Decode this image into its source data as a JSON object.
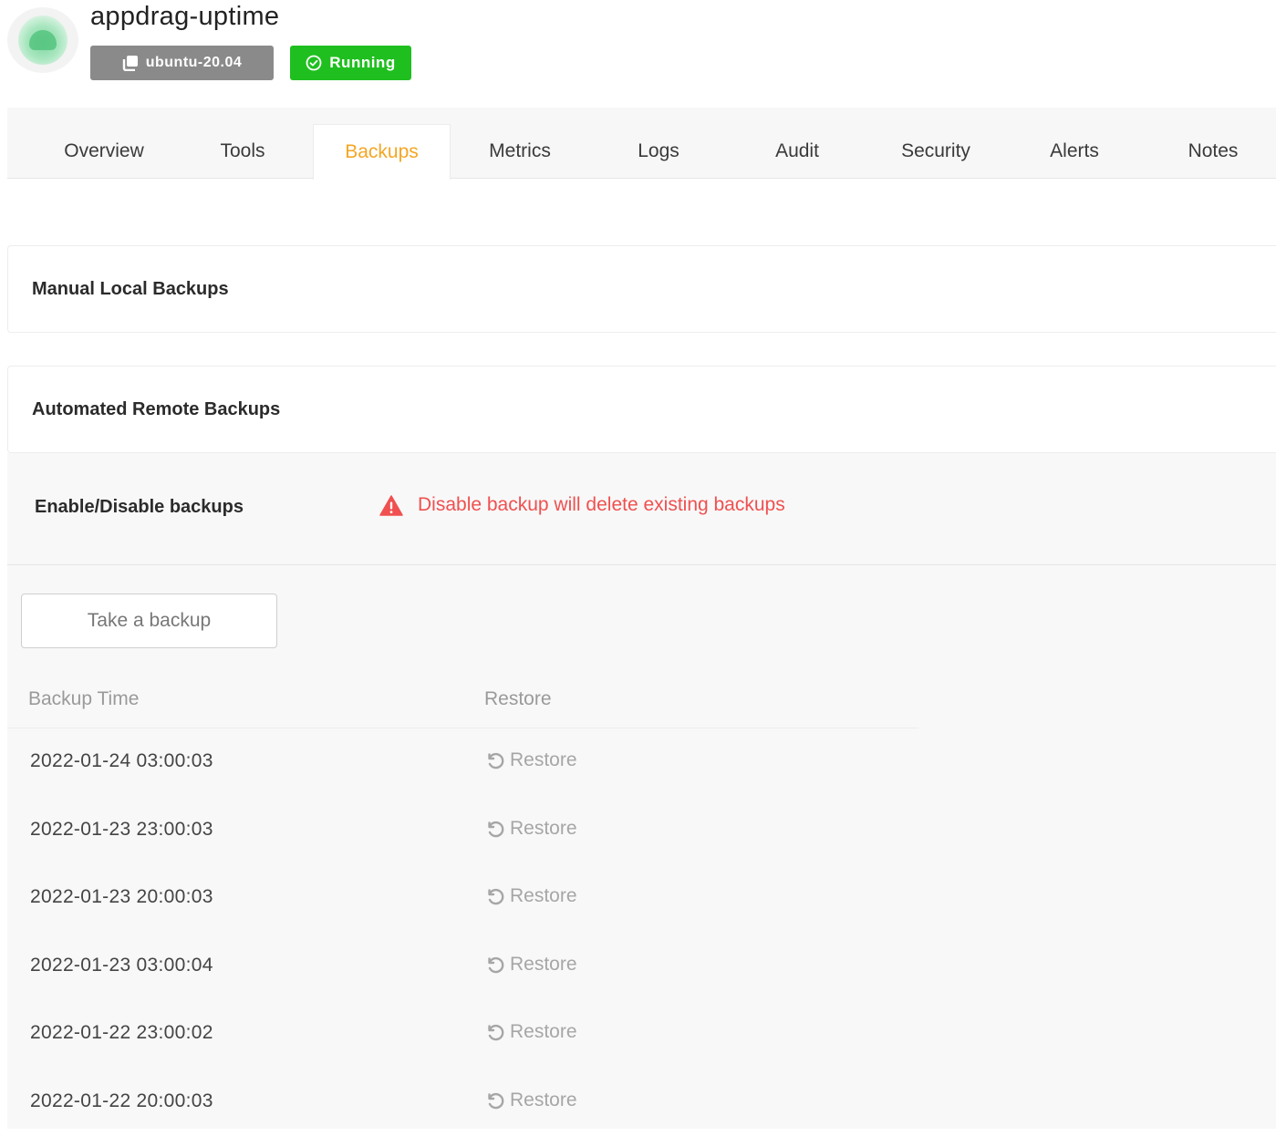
{
  "app": {
    "title": "appdrag-uptime",
    "os_badge": "ubuntu-20.04",
    "status_badge": "Running",
    "colors": {
      "status": "#1fbf1f",
      "os_badge": "#8a8a8a",
      "accent": "#f5a623",
      "warning": "#f05050"
    }
  },
  "tabs": [
    {
      "label": "Overview"
    },
    {
      "label": "Tools"
    },
    {
      "label": "Backups",
      "active": true
    },
    {
      "label": "Metrics"
    },
    {
      "label": "Logs"
    },
    {
      "label": "Audit"
    },
    {
      "label": "Security"
    },
    {
      "label": "Alerts"
    },
    {
      "label": "Notes"
    }
  ],
  "sections": {
    "manual": {
      "title": "Manual Local Backups"
    },
    "remote": {
      "title": "Automated Remote Backups",
      "enable_label": "Enable/Disable backups",
      "warning_text": "Disable backup will delete existing backups",
      "warning_icon": "warning-triangle-icon",
      "take_backup_label": "Take a backup",
      "table": {
        "columns": [
          "Backup Time",
          "Restore"
        ],
        "rows": [
          {
            "time": "2022-01-24 03:00:03",
            "action": "Restore"
          },
          {
            "time": "2022-01-23 23:00:03",
            "action": "Restore"
          },
          {
            "time": "2022-01-23 20:00:03",
            "action": "Restore"
          },
          {
            "time": "2022-01-23 03:00:04",
            "action": "Restore"
          },
          {
            "time": "2022-01-22 23:00:02",
            "action": "Restore"
          },
          {
            "time": "2022-01-22 20:00:03",
            "action": "Restore"
          }
        ]
      }
    }
  }
}
